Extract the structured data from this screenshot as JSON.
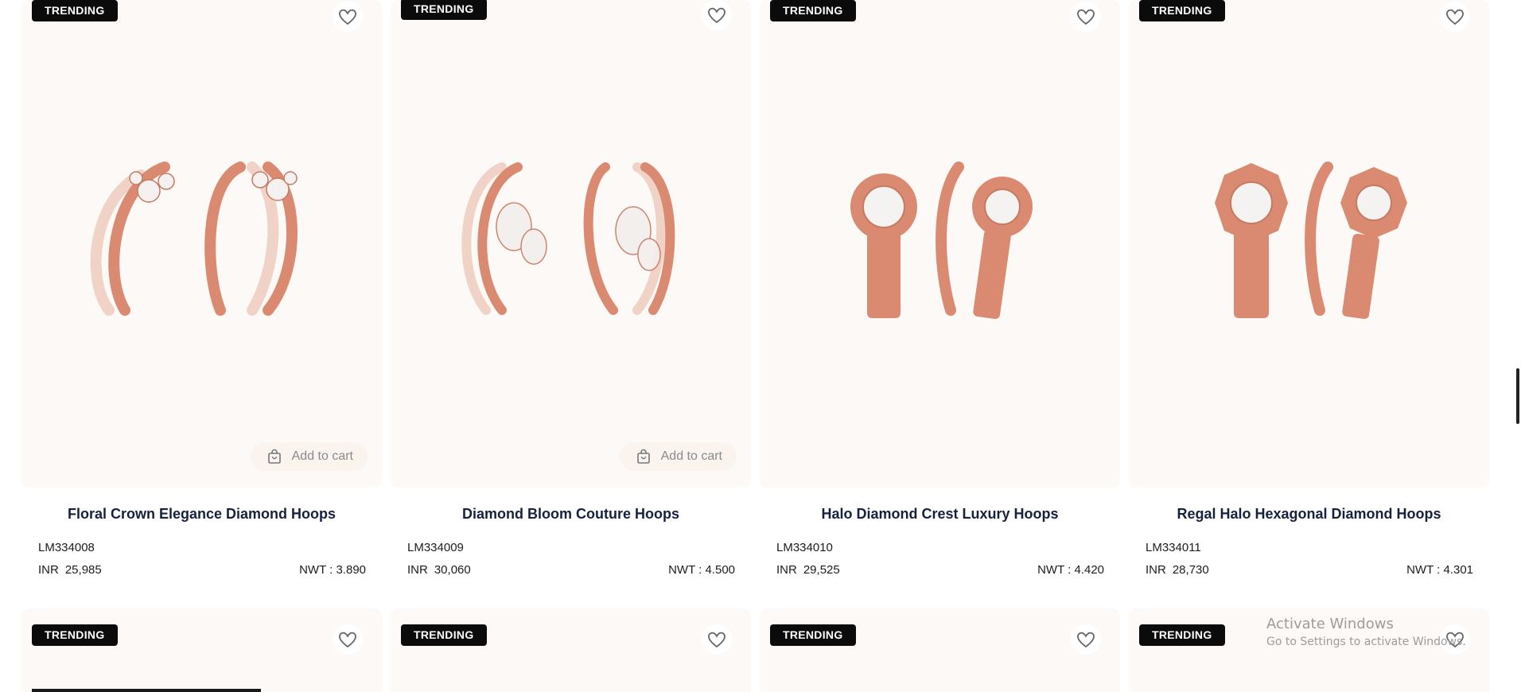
{
  "badge_label": "TRENDING",
  "add_to_cart_label": "Add to cart",
  "products": [
    {
      "title": "Floral Crown Elegance Diamond Hoops",
      "sku": "LM334008",
      "currency": "INR",
      "price": "25,985",
      "nwt": "NWT : 3.890",
      "show_cart": true
    },
    {
      "title": "Diamond Bloom Couture Hoops",
      "sku": "LM334009",
      "currency": "INR",
      "price": "30,060",
      "nwt": "NWT : 4.500",
      "show_cart": true
    },
    {
      "title": "Halo Diamond Crest Luxury Hoops",
      "sku": "LM334010",
      "currency": "INR",
      "price": "29,525",
      "nwt": "NWT : 4.420",
      "show_cart": false
    },
    {
      "title": "Regal Halo Hexagonal Diamond Hoops",
      "sku": "LM334011",
      "currency": "INR",
      "price": "28,730",
      "nwt": "NWT : 4.301",
      "show_cart": false
    }
  ],
  "watermark": {
    "line1": "Activate Windows",
    "line2": "Go to Settings to activate Windows."
  },
  "colors": {
    "card_bg": "#fdf9f6",
    "badge_bg": "#0b0b0b",
    "title_color": "#16213e",
    "metal_rose_gold": "#d98a70"
  },
  "icons": {
    "wishlist": "heart-outline-icon",
    "cart": "shopping-bag-icon"
  }
}
